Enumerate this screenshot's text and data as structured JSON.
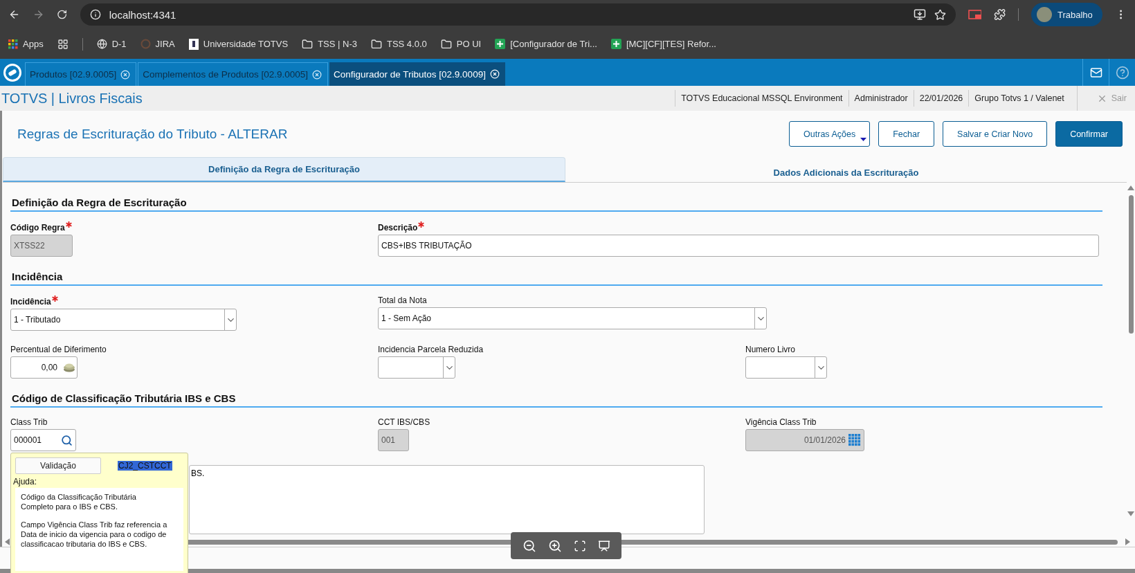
{
  "browser": {
    "url": "localhost:4341",
    "profile": "Trabalho",
    "bookmarks": [
      {
        "kind": "apps",
        "label": "Apps"
      },
      {
        "kind": "grid"
      },
      {
        "kind": "globe",
        "label": "D-1"
      },
      {
        "kind": "ring",
        "label": "JIRA"
      },
      {
        "kind": "doc",
        "label": "Universidade TOTVS"
      },
      {
        "kind": "folder",
        "label": "TSS | N-3"
      },
      {
        "kind": "folder",
        "label": "TSS 4.0.0"
      },
      {
        "kind": "folder",
        "label": "PO UI"
      },
      {
        "kind": "sheet",
        "label": "[Configurador de Tri..."
      },
      {
        "kind": "sheet",
        "label": "[MC][CF][TES] Refor..."
      }
    ]
  },
  "app_tabs": [
    {
      "label": "Produtos [02.9.0005]",
      "selected": false
    },
    {
      "label": "Complementos de Produtos [02.9.0005]",
      "selected": false
    },
    {
      "label": "Configurador de Tributos [02.9.0009]",
      "selected": true
    }
  ],
  "header": {
    "title": "TOTVS | Livros Fiscais",
    "info": [
      "TOTVS Educacional MSSQL Environment",
      "Administrador",
      "22/01/2026",
      "Grupo Totvs 1 / Valenet"
    ],
    "logout": "Sair"
  },
  "page": {
    "title": "Regras de Escrituração do Tributo - ALTERAR",
    "actions": [
      {
        "kind": "menu",
        "label": "Outras Ações"
      },
      {
        "kind": "outline",
        "label": "Fechar"
      },
      {
        "kind": "outline",
        "label": "Salvar e Criar Novo"
      },
      {
        "kind": "primary",
        "label": "Confirmar"
      }
    ]
  },
  "form_tabs": [
    {
      "label": "Definição da Regra de Escrituração",
      "selected": true
    },
    {
      "label": "Dados Adicionais da Escrituração",
      "selected": false
    }
  ],
  "sections": [
    {
      "title": "Definição da Regra de Escrituração",
      "rows": [
        [
          {
            "label": "Código Regra",
            "required": true,
            "kind": "text",
            "value": "XTSS22",
            "disabled": true
          },
          {
            "label": "Descrição",
            "required": true,
            "kind": "text",
            "value": "CBS+IBS TRIBUTAÇÃO",
            "disabled": false
          }
        ]
      ]
    },
    {
      "title": "Incidência",
      "rows": [
        [
          {
            "label": "Incidência",
            "required": true,
            "kind": "select",
            "value": "1 - Tributado",
            "disabled": false
          },
          {
            "label": "Total da Nota",
            "required": false,
            "kind": "select",
            "value": "1 - Sem Ação",
            "disabled": false
          }
        ],
        [
          {
            "label": "Percentual de Diferimento",
            "required": false,
            "kind": "number",
            "value": "0,00",
            "disabled": false
          },
          {
            "label": "Incidencia Parcela Reduzida",
            "required": false,
            "kind": "select",
            "disabled": false
          },
          {
            "label": "Numero Livro",
            "required": false,
            "kind": "select",
            "disabled": false
          }
        ]
      ]
    },
    {
      "title": "Código de Classificação Tributária IBS e CBS",
      "rows": [
        [
          {
            "label": "Class Trib",
            "required": false,
            "kind": "lookup",
            "value": "000001",
            "disabled": false
          },
          {
            "label": "CCT IBS/CBS",
            "required": false,
            "kind": "text",
            "value": "001",
            "disabled": true
          },
          {
            "label": "Vigência Class Trib",
            "required": false,
            "kind": "date",
            "value": "01/01/2026",
            "disabled": true
          }
        ]
      ],
      "memo": "BS."
    }
  ],
  "help_popup": {
    "button": "Validação",
    "field_id": "CJ2_CSTCCT",
    "heading": "Ajuda:",
    "paragraphs": [
      "Código da Classificação Tributária Completo para o IBS e CBS.",
      "Campo Vigência Class Trib faz referencia a Data de inicio da vigencia para o codigo de classificacao tributaria do IBS e CBS."
    ]
  }
}
